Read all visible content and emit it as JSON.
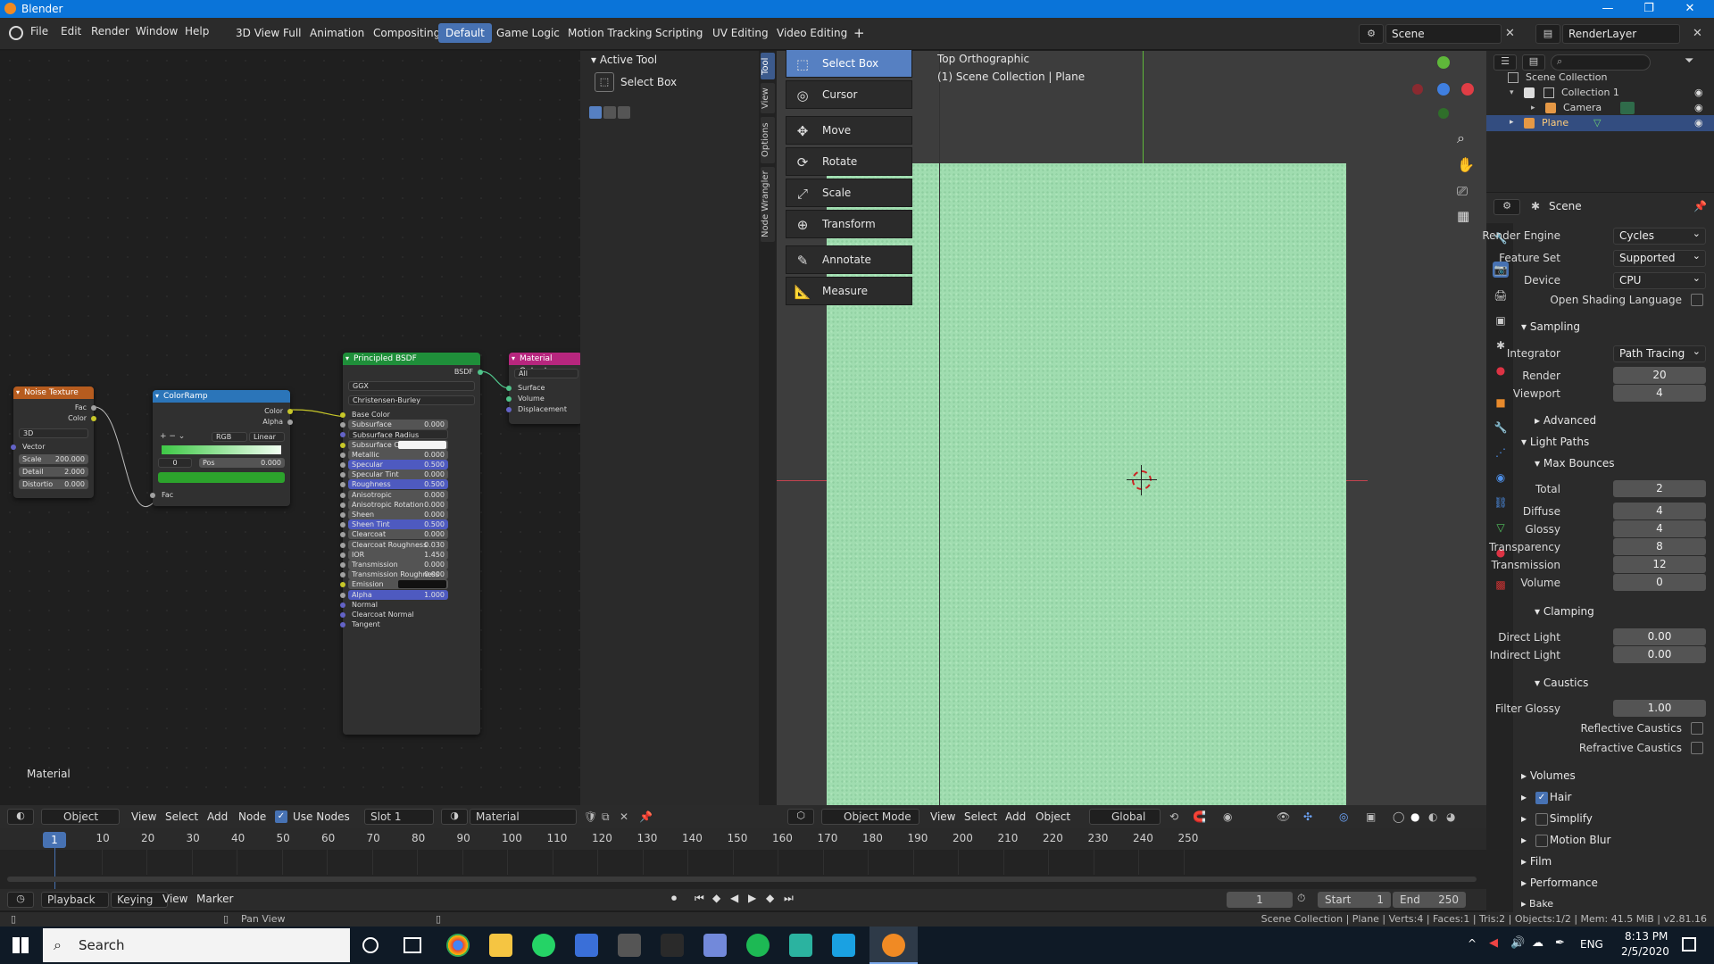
{
  "window": {
    "title": "Blender"
  },
  "topbar": {
    "menus": [
      "File",
      "Edit",
      "Render",
      "Window",
      "Help"
    ],
    "workspaces": [
      "3D View Full",
      "Animation",
      "Compositing",
      "Default",
      "Game Logic",
      "Motion Tracking",
      "Scripting",
      "UV Editing",
      "Video Editing"
    ],
    "active_workspace": "Default",
    "scene": "Scene",
    "view_layer": "RenderLayer"
  },
  "node_editor": {
    "material_label": "Material",
    "noise_texture": {
      "title": "Noise Texture",
      "out_fac": "Fac",
      "out_color": "Color",
      "dim": "3D",
      "in_vector": "Vector",
      "scale": "Scale",
      "scale_val": "200.000",
      "detail": "Detail",
      "detail_val": "2.000",
      "distortion": "Distortio",
      "distortion_val": "0.000"
    },
    "color_ramp": {
      "title": "ColorRamp",
      "out_color": "Color",
      "out_alpha": "Alpha",
      "mode": "RGB",
      "interp": "Linear",
      "index": "0",
      "pos_label": "Pos",
      "pos_val": "0.000",
      "in_fac": "Fac"
    },
    "principled": {
      "title": "Principled BSDF",
      "out": "BSDF",
      "distribution": "GGX",
      "subsurface_method": "Christensen-Burley",
      "rows": [
        {
          "label": "Base Color",
          "value": ""
        },
        {
          "label": "Subsurface",
          "value": "0.000"
        },
        {
          "label": "Subsurface Radius",
          "value": ""
        },
        {
          "label": "Subsurface Color",
          "value": ""
        },
        {
          "label": "Metallic",
          "value": "0.000"
        },
        {
          "label": "Specular",
          "value": "0.500"
        },
        {
          "label": "Specular Tint",
          "value": "0.000"
        },
        {
          "label": "Roughness",
          "value": "0.500"
        },
        {
          "label": "Anisotropic",
          "value": "0.000"
        },
        {
          "label": "Anisotropic Rotation",
          "value": "0.000"
        },
        {
          "label": "Sheen",
          "value": "0.000"
        },
        {
          "label": "Sheen Tint",
          "value": "0.500"
        },
        {
          "label": "Clearcoat",
          "value": "0.000"
        },
        {
          "label": "Clearcoat Roughness",
          "value": "0.030"
        },
        {
          "label": "IOR",
          "value": "1.450"
        },
        {
          "label": "Transmission",
          "value": "0.000"
        },
        {
          "label": "Transmission Roughness",
          "value": "0.000"
        },
        {
          "label": "Emission",
          "value": ""
        },
        {
          "label": "Alpha",
          "value": "1.000"
        },
        {
          "label": "Normal",
          "value": ""
        },
        {
          "label": "Clearcoat Normal",
          "value": ""
        },
        {
          "label": "Tangent",
          "value": ""
        }
      ]
    },
    "material_output": {
      "title": "Material Output",
      "target": "All",
      "surface": "Surface",
      "volume": "Volume",
      "displacement": "Displacement"
    }
  },
  "npanel": {
    "header": "Active Tool",
    "tool": "Select Box"
  },
  "vtabs": [
    "Tool",
    "View",
    "Options",
    "Node Wrangler"
  ],
  "viewport": {
    "view_name": "Top Orthographic",
    "collection_info": "(1) Scene Collection | Plane",
    "tools": [
      "Select Box",
      "Cursor",
      "Move",
      "Rotate",
      "Scale",
      "Transform",
      "Annotate",
      "Measure"
    ]
  },
  "outliner": {
    "root": "Scene Collection",
    "items": [
      "Collection 1",
      "Camera",
      "Plane"
    ]
  },
  "properties": {
    "context": "Scene",
    "render_engine_label": "Render Engine",
    "render_engine": "Cycles",
    "feature_set_label": "Feature Set",
    "feature_set": "Supported",
    "device_label": "Device",
    "device": "CPU",
    "osl_label": "Open Shading Language",
    "sampling": "Sampling",
    "integrator_label": "Integrator",
    "integrator": "Path Tracing",
    "render_label": "Render",
    "render": "20",
    "viewport_label": "Viewport",
    "viewport": "4",
    "advanced": "Advanced",
    "light_paths": "Light Paths",
    "max_bounces": "Max Bounces",
    "total_label": "Total",
    "total": "2",
    "diffuse_label": "Diffuse",
    "diffuse": "4",
    "glossy_label": "Glossy",
    "glossy": "4",
    "transparency_label": "Transparency",
    "transparency": "8",
    "transmission_label": "Transmission",
    "transmission": "12",
    "volume_label": "Volume",
    "volume": "0",
    "clamping": "Clamping",
    "direct_label": "Direct Light",
    "direct": "0.00",
    "indirect_label": "Indirect Light",
    "indirect": "0.00",
    "caustics": "Caustics",
    "filter_glossy_label": "Filter Glossy",
    "filter_glossy": "1.00",
    "reflective_label": "Reflective Caustics",
    "refractive_label": "Refractive Caustics",
    "sections": [
      "Volumes",
      "Hair",
      "Simplify",
      "Motion Blur",
      "Film",
      "Performance",
      "Bake"
    ]
  },
  "node_header": {
    "mode": "Object",
    "menus": [
      "View",
      "Select",
      "Add",
      "Node"
    ],
    "use_nodes": "Use Nodes",
    "slot": "Slot 1",
    "material": "Material"
  },
  "view_header": {
    "mode": "Object Mode",
    "menus": [
      "View",
      "Select",
      "Add",
      "Object"
    ],
    "orientation": "Global"
  },
  "timeline": {
    "current_frame": "1",
    "ticks": [
      "10",
      "20",
      "30",
      "40",
      "50",
      "60",
      "70",
      "80",
      "90",
      "100",
      "110",
      "120",
      "130",
      "140",
      "150",
      "160",
      "170",
      "180",
      "190",
      "200",
      "210",
      "220",
      "230",
      "240",
      "250"
    ],
    "menus": [
      "Playback",
      "Keying",
      "View",
      "Marker"
    ],
    "frame": "1",
    "start_label": "Start",
    "start": "1",
    "end_label": "End",
    "end": "250"
  },
  "statusbar": {
    "hint": "Pan View",
    "info": "Scene Collection | Plane | Verts:4 | Faces:1 | Tris:2 | Objects:1/2 | Mem: 41.5 MiB | v2.81.16"
  },
  "taskbar": {
    "search": "Search",
    "lang": "ENG",
    "time": "8:13 PM",
    "date": "2/5/2020"
  }
}
